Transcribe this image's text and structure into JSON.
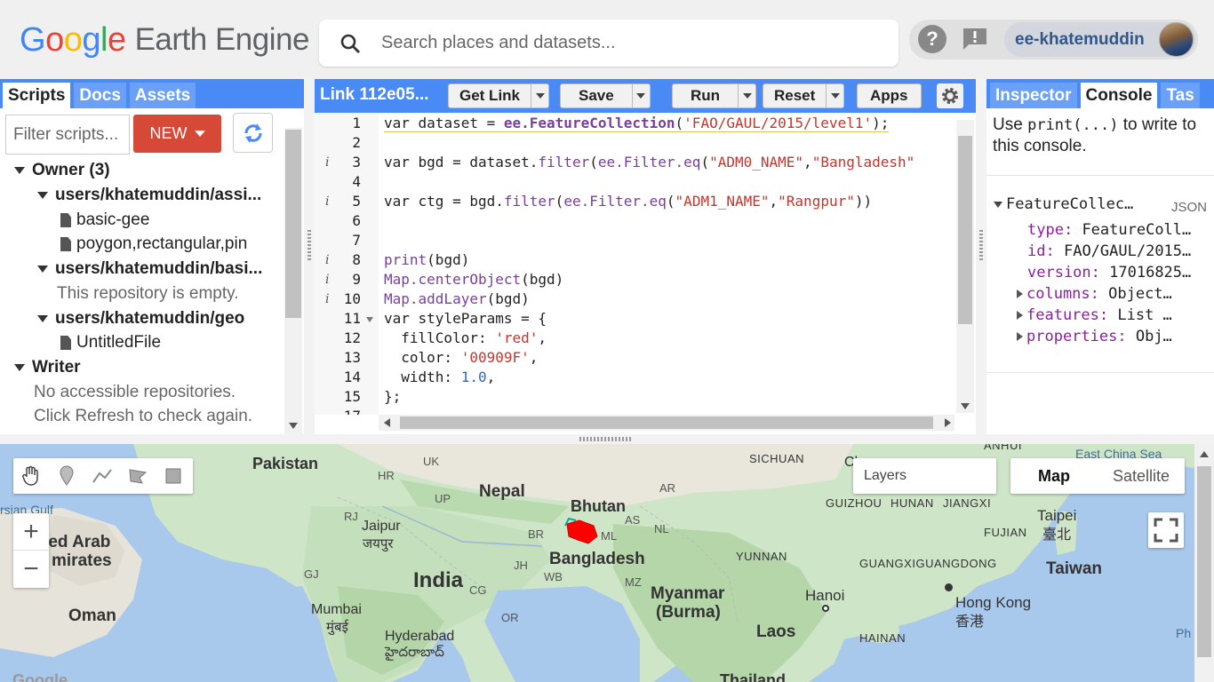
{
  "header": {
    "logo_google": [
      "G",
      "o",
      "o",
      "g",
      "l",
      "e"
    ],
    "logo_product": "Earth Engine",
    "search_placeholder": "Search places and datasets...",
    "user_name": "ee-khatemuddin"
  },
  "left_panel": {
    "tabs": [
      "Scripts",
      "Docs",
      "Assets"
    ],
    "active_tab": "Scripts",
    "filter_placeholder": "Filter scripts...",
    "new_label": "NEW",
    "tree": {
      "owner_label": "Owner (3)",
      "repo1": "users/khatemuddin/assi...",
      "repo1_files": [
        "basic-gee",
        "poygon,rectangular,pin"
      ],
      "repo2": "users/khatemuddin/basi...",
      "repo2_empty": "This repository is empty.",
      "repo3": "users/khatemuddin/geo",
      "repo3_files": [
        "UntitledFile"
      ],
      "writer_label": "Writer",
      "writer_msg1": "No accessible repositories.",
      "writer_msg2": "Click Refresh to check again."
    }
  },
  "editor": {
    "title": "Link 112e05...",
    "buttons": {
      "get_link": "Get Link",
      "save": "Save",
      "run": "Run",
      "reset": "Reset",
      "apps": "Apps"
    },
    "line_numbers": [
      "1",
      "2",
      "3",
      "4",
      "5",
      "6",
      "7",
      "8",
      "9",
      "10",
      "11",
      "12",
      "13",
      "14",
      "15",
      "16",
      "17"
    ]
  },
  "right_panel": {
    "tabs": [
      "Inspector",
      "Console",
      "Tas"
    ],
    "active_tab": "Console",
    "hint_before": "Use ",
    "hint_code": "print(...)",
    "hint_after": " to write to this console.",
    "object": {
      "title": "FeatureCollec…",
      "json_label": "JSON",
      "type_key": "type:",
      "type_val": "FeatureColl…",
      "id_key": "id:",
      "id_val": "FAO/GAUL/2015…",
      "version_key": "version:",
      "version_val": "17016825…",
      "columns_key": "columns:",
      "columns_val": "Object…",
      "features_key": "features:",
      "features_val": "List …",
      "properties_key": "properties:",
      "properties_val": "Obj…"
    }
  },
  "map": {
    "layers_label": "Layers",
    "map_type_options": [
      "Map",
      "Satellite"
    ],
    "selected_map_type": "Map",
    "zoom_in": "+",
    "zoom_out": "−",
    "labels": {
      "pakistan": "Pakistan",
      "nepal": "Nepal",
      "bhutan": "Bhutan",
      "bangladesh": "Bangladesh",
      "india": "India",
      "myanmar": "Myanmar",
      "burma": "(Burma)",
      "laos": "Laos",
      "thailand": "Thailand",
      "hanoi": "Hanoi",
      "hongkong": "Hong Kong",
      "hongkong_zh": "香港",
      "taiwan": "Taiwan",
      "taipei": "Taipei",
      "taipei_zh": "臺北",
      "oman": "Oman",
      "uae1": "ted Arab",
      "uae2": "mirates",
      "gulf": "rsian Gulf",
      "jaipur": "Jaipur",
      "jaipur_hi": "जयपुर",
      "mumbai": "Mumbai",
      "mumbai_mr": "मुंबई",
      "hyderabad": "Hyderabad",
      "hyderabad_te": "హైదరాబాద్",
      "sichuan": "SICHUAN",
      "guizhou": "GUIZHOU",
      "hunan": "HUNAN",
      "jiangxi": "JIANGXI",
      "fujian": "FUJIAN",
      "guangdong": "GUANGXIGUANGDONG",
      "yunnan": "YUNNAN",
      "hainan": "HAINAN",
      "anhui": "ANHUI",
      "east_china_sea": "East China Sea",
      "ph": "Ph",
      "uk": "UK",
      "hr": "HR",
      "up": "UP",
      "rj": "RJ",
      "gj": "GJ",
      "br": "BR",
      "jh": "JH",
      "wb": "WB",
      "cg": "CG",
      "or": "OR",
      "as": "AS",
      "ml": "ML",
      "nl": "NL",
      "ar": "AR",
      "mz": "MZ",
      "ch": "Ch",
      "google": "Google"
    }
  }
}
